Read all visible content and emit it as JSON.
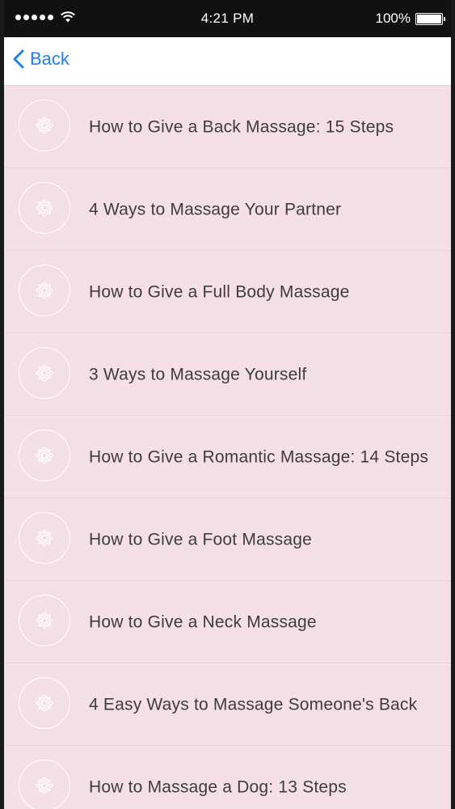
{
  "status_bar": {
    "time": "4:21 PM",
    "battery": "100%"
  },
  "nav": {
    "back_label": "Back"
  },
  "articles": [
    "How to Give a Back Massage: 15 Steps",
    "4 Ways to Massage Your Partner",
    "How to Give a Full Body Massage",
    "3 Ways to Massage Yourself",
    "How to Give a Romantic Massage: 14 Steps",
    "How to Give a Foot Massage",
    "How to Give a Neck Massage",
    "4 Easy Ways to Massage Someone's Back",
    "How to Massage a Dog: 13 Steps"
  ],
  "icons": {
    "row_icon": "flower-icon",
    "back": "chevron-left-icon",
    "wifi": "wifi-icon",
    "battery": "battery-icon",
    "signal": "signal-dots-icon"
  },
  "colors": {
    "list_background": "#f5dfe6",
    "accent": "#1e7ef3",
    "text": "#3d3d3d"
  }
}
